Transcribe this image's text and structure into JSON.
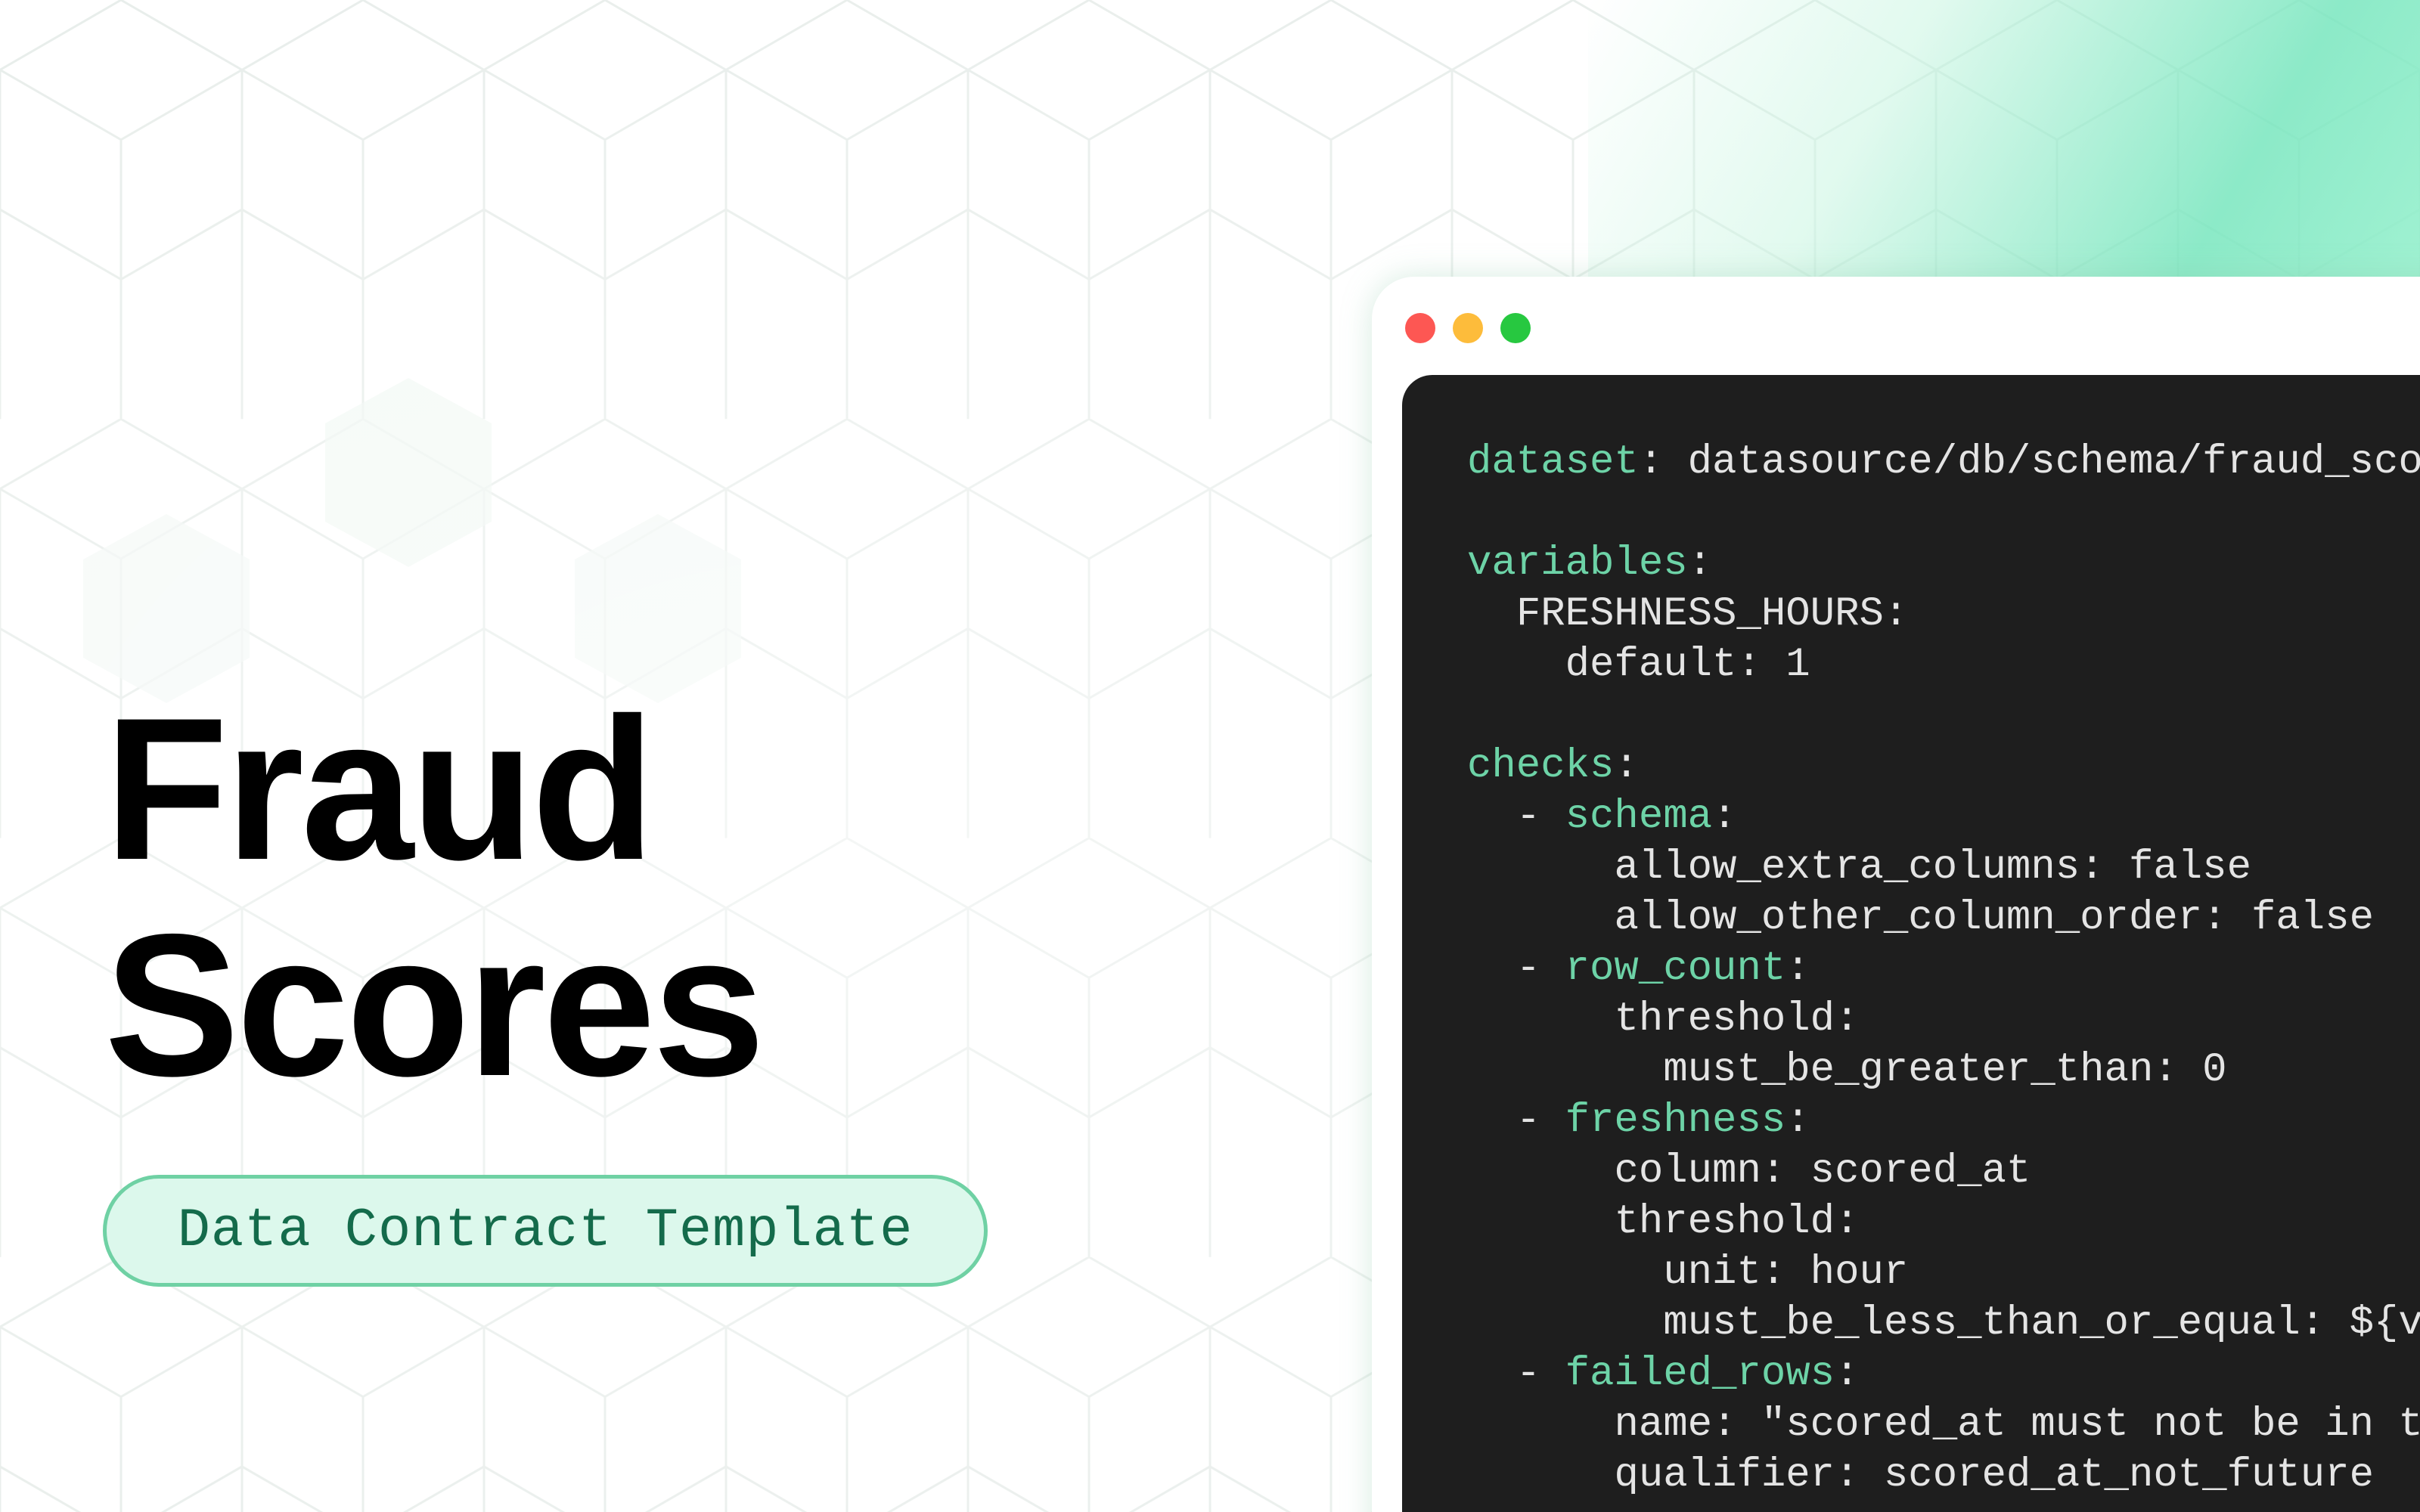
{
  "colors": {
    "background": "#ffffff",
    "accent": "#6fd1a4",
    "pill_bg": "#dcf8ec",
    "pill_text": "#146b4b",
    "editor_bg": "#1e1e1e",
    "code_key": "#6dd3a7",
    "code_text": "#e4e4e4",
    "traffic_red": "#fd5753",
    "traffic_yellow": "#fdbc3b",
    "traffic_green": "#27c840"
  },
  "hero": {
    "title_line1": "Fraud",
    "title_line2": "Scores",
    "badge": "Data Contract Template"
  },
  "window": {
    "controls": [
      "close-icon",
      "minimize-icon",
      "maximize-icon"
    ],
    "code_lines": [
      {
        "indent": "",
        "key": "dataset",
        "rest": ": datasource/db/schema/fraud_sco"
      },
      {
        "indent": "",
        "key": "",
        "rest": ""
      },
      {
        "indent": "",
        "key": "variables",
        "rest": ":"
      },
      {
        "indent": "  ",
        "key": "",
        "rest": "FRESHNESS_HOURS:"
      },
      {
        "indent": "    ",
        "key": "",
        "rest": "default: 1"
      },
      {
        "indent": "",
        "key": "",
        "rest": ""
      },
      {
        "indent": "",
        "key": "checks",
        "rest": ":"
      },
      {
        "indent": "  - ",
        "key": "schema",
        "rest": ":"
      },
      {
        "indent": "      ",
        "key": "",
        "rest": "allow_extra_columns: false"
      },
      {
        "indent": "      ",
        "key": "",
        "rest": "allow_other_column_order: false"
      },
      {
        "indent": "  - ",
        "key": "row_count",
        "rest": ":"
      },
      {
        "indent": "      ",
        "key": "",
        "rest": "threshold:"
      },
      {
        "indent": "        ",
        "key": "",
        "rest": "must_be_greater_than: 0"
      },
      {
        "indent": "  - ",
        "key": "freshness",
        "rest": ":"
      },
      {
        "indent": "      ",
        "key": "",
        "rest": "column: scored_at"
      },
      {
        "indent": "      ",
        "key": "",
        "rest": "threshold:"
      },
      {
        "indent": "        ",
        "key": "",
        "rest": "unit: hour"
      },
      {
        "indent": "        ",
        "key": "",
        "rest": "must_be_less_than_or_equal: ${v"
      },
      {
        "indent": "  - ",
        "key": "failed_rows",
        "rest": ":"
      },
      {
        "indent": "      ",
        "key": "",
        "rest": "name: \"scored_at must not be in t"
      },
      {
        "indent": "      ",
        "key": "",
        "rest": "qualifier: scored_at_not_future"
      }
    ]
  }
}
